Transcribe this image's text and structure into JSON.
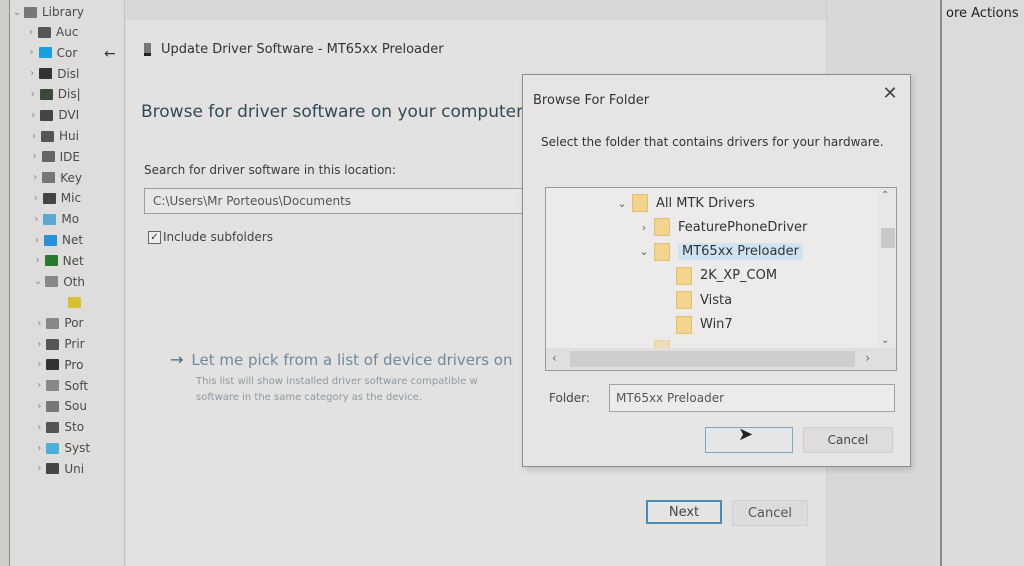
{
  "device_manager": {
    "root": "Library",
    "items": [
      {
        "label": "Auc",
        "icon": "speaker-icon",
        "color": "#555555"
      },
      {
        "label": "Cor",
        "icon": "monitor-icon",
        "color": "#1aa0e0"
      },
      {
        "label": "Disl",
        "icon": "disk-drive-icon",
        "color": "#333333"
      },
      {
        "label": "Dis|",
        "icon": "display-adapter-icon",
        "color": "#3a4a3a"
      },
      {
        "label": "DVI",
        "icon": "dvd-drive-icon",
        "color": "#444444"
      },
      {
        "label": "Hui",
        "icon": "hid-icon",
        "color": "#555555"
      },
      {
        "label": "IDE",
        "icon": "ide-controller-icon",
        "color": "#666666"
      },
      {
        "label": "Key",
        "icon": "keyboard-icon",
        "color": "#777777"
      },
      {
        "label": "Mic",
        "icon": "mouse-icon",
        "color": "#444444"
      },
      {
        "label": "Mo",
        "icon": "monitors-icon",
        "color": "#5aa8d0"
      },
      {
        "label": "Net",
        "icon": "network-adapter-icon",
        "color": "#2a90d8"
      },
      {
        "label": "Net",
        "icon": "network-icon",
        "color": "#2a7a2a"
      },
      {
        "label": "Oth",
        "icon": "other-devices-icon",
        "color": "#888888",
        "expanded": true
      },
      {
        "label": "",
        "icon": "warning-device-icon",
        "color": "#d8c030",
        "child": true
      },
      {
        "label": "Por",
        "icon": "ports-icon",
        "color": "#888888"
      },
      {
        "label": "Prir",
        "icon": "printer-icon",
        "color": "#555555"
      },
      {
        "label": "Pro",
        "icon": "processor-icon",
        "color": "#333333"
      },
      {
        "label": "Soft",
        "icon": "software-device-icon",
        "color": "#888888"
      },
      {
        "label": "Sou",
        "icon": "sound-icon",
        "color": "#777777"
      },
      {
        "label": "Sto",
        "icon": "storage-icon",
        "color": "#555555"
      },
      {
        "label": "Syst",
        "icon": "system-device-icon",
        "color": "#4ab0d8"
      },
      {
        "label": "Uni",
        "icon": "usb-icon",
        "color": "#444444"
      }
    ]
  },
  "update_window": {
    "title": "Update Driver Software - MT65xx Preloader",
    "heading": "Browse for driver software on your computer",
    "search_label": "Search for driver software in this location:",
    "path_value": "C:\\Users\\Mr Porteous\\Documents",
    "include_subfolders_label": "Include subfolders",
    "include_subfolders_checked": true,
    "pick_link": "Let me pick from a list of device drivers on",
    "pick_desc_line1": "This list will show installed driver software compatible w",
    "pick_desc_line2": "software in the same category as the device.",
    "next_label": "Next",
    "cancel_label": "Cancel"
  },
  "actions_panel": {
    "title": "ore Actions"
  },
  "browse_dialog": {
    "title": "Browse For Folder",
    "instruction": "Select the folder that contains drivers for your hardware.",
    "tree": [
      {
        "label": "All MTK Drivers",
        "expanded": true,
        "level": 0
      },
      {
        "label": "FeaturePhoneDriver",
        "expanded": false,
        "level": 1
      },
      {
        "label": "MT65xx Preloader",
        "expanded": true,
        "level": 1,
        "selected": true
      },
      {
        "label": "2K_XP_COM",
        "level": 2
      },
      {
        "label": "Vista",
        "level": 2
      },
      {
        "label": "Win7",
        "level": 2
      },
      {
        "label": "...",
        "level": 1,
        "partial": true
      }
    ],
    "folder_label": "Folder:",
    "folder_value": "MT65xx Preloader",
    "ok_label": "",
    "cancel_label": "Cancel"
  },
  "colors": {
    "accent": "#4a8cb5",
    "selection": "#cfe4f2",
    "folder": "#f1d48e"
  }
}
